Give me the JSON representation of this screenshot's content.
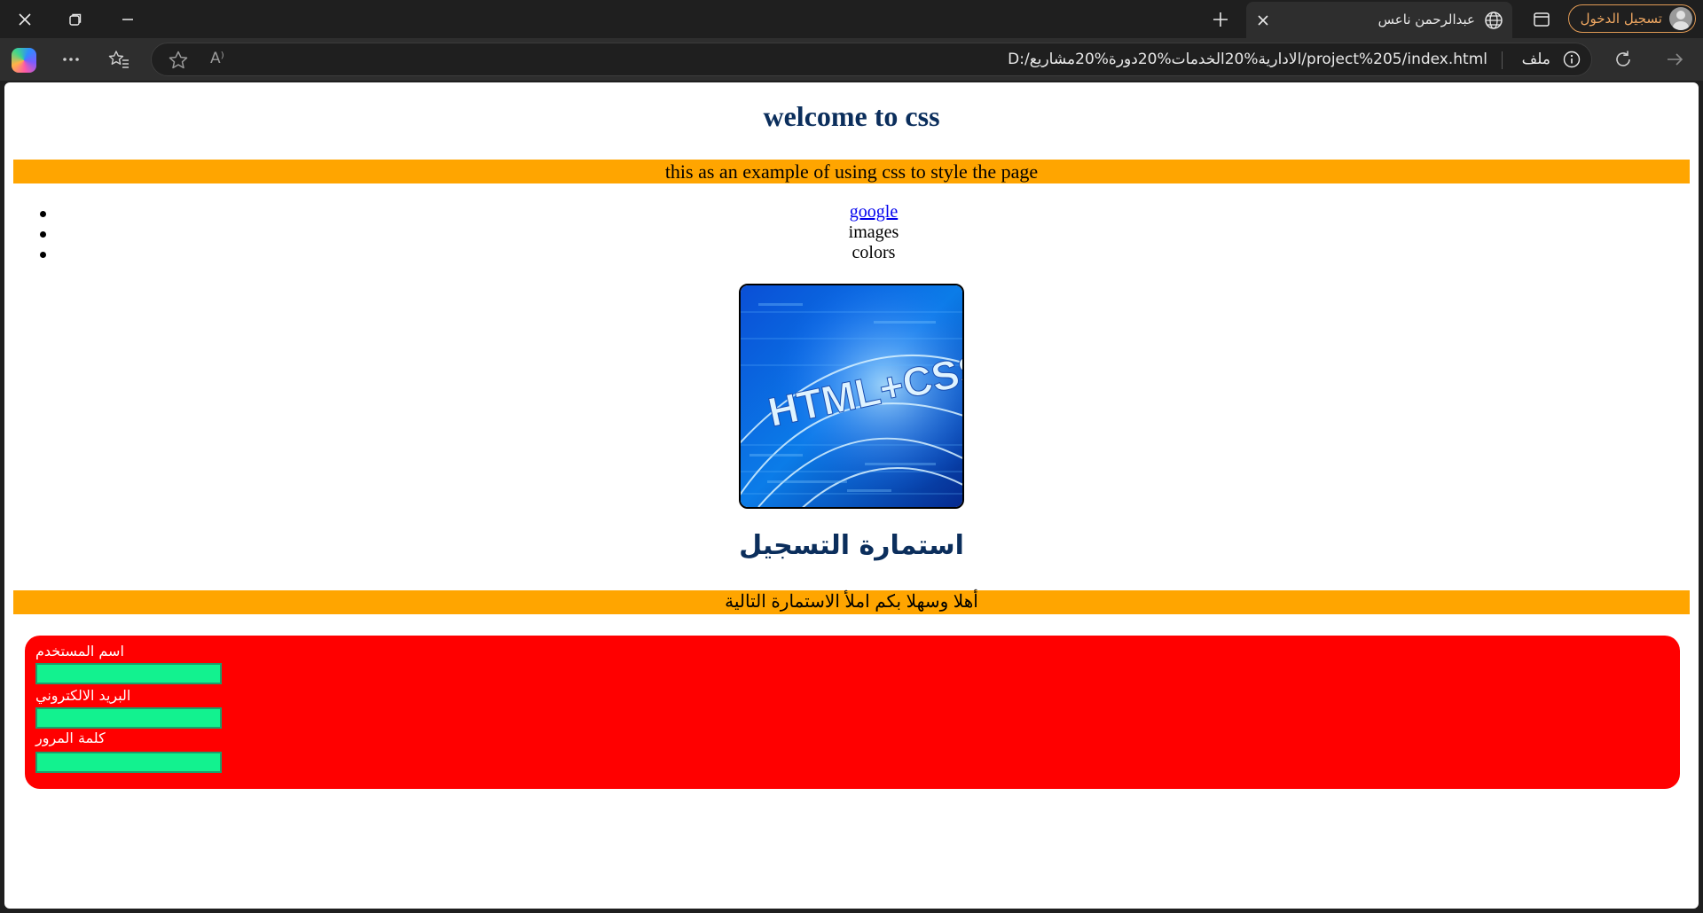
{
  "browser": {
    "tab_title": "عبدالرحمن ناعس",
    "signin_label": "تسجيل الدخول",
    "file_label": "ملف",
    "url": "D:/الادارية%20الخدمات%20دورة%20مشاريع/project%205/index.html",
    "read_aloud_glyph": "A⁾",
    "icons": [
      "close-icon",
      "restore-icon",
      "minimize-icon",
      "plus-icon",
      "globe-icon",
      "tab-actions-icon",
      "avatar-icon",
      "copilot-icon",
      "more-icon",
      "favorites-icon",
      "star-icon",
      "read-aloud-icon",
      "info-icon",
      "refresh-icon",
      "back-arrow-icon"
    ]
  },
  "page": {
    "welcome_heading": "welcome to css",
    "intro_band": "this as an example of using css to style the page",
    "nav": [
      {
        "label": "google",
        "link": true
      },
      {
        "label": "images",
        "link": false
      },
      {
        "label": "colors",
        "link": false
      }
    ],
    "hero_image_text": "HTML+CSS",
    "form_heading": "استمارة التسجيل",
    "form_intro": "أهلا وسهلا بكم املأ الاستمارة التالية",
    "form": {
      "username_label": "اسم المستخدم",
      "email_label": "البريد الالكتروني",
      "password_label": "كلمة المرور"
    }
  },
  "colors": {
    "heading": "#0b2e5c",
    "band": "#ffa500",
    "form_bg": "#ff0000",
    "input_bg": "#12f28f",
    "link": "#0000ee"
  }
}
